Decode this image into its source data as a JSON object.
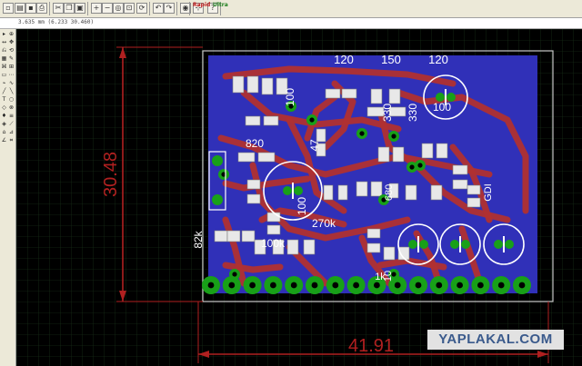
{
  "toolbar": {
    "buttons": [
      {
        "name": "new-file-icon",
        "glyph": "▫"
      },
      {
        "name": "open-folder-icon",
        "glyph": "▤"
      },
      {
        "name": "save-icon",
        "glyph": "▪"
      },
      {
        "name": "print-icon",
        "glyph": "⎙"
      },
      {
        "name": "cut-icon",
        "glyph": "✂"
      },
      {
        "name": "copy-icon",
        "glyph": "❐"
      },
      {
        "name": "paste-icon",
        "glyph": "▣"
      },
      {
        "name": "zoom-in-icon",
        "glyph": "+"
      },
      {
        "name": "zoom-out-icon",
        "glyph": "−"
      },
      {
        "name": "zoom-fit-icon",
        "glyph": "◎"
      },
      {
        "name": "zoom-window-icon",
        "glyph": "⊡"
      },
      {
        "name": "redraw-icon",
        "glyph": "⟳"
      },
      {
        "name": "undo-icon",
        "glyph": "↶"
      },
      {
        "name": "redo-icon",
        "glyph": "↷"
      },
      {
        "name": "stop-icon",
        "glyph": "◉"
      },
      {
        "name": "select-icon",
        "glyph": "⊹"
      },
      {
        "name": "help-icon",
        "glyph": "?"
      }
    ],
    "badge_rapid": "Rapid",
    "badge_ultra": "Ultra"
  },
  "status": {
    "coordinates": "3.635 mm (6.233 30.460)"
  },
  "left_tools": [
    "▸",
    "⊕",
    "↔",
    "✥",
    "⎌",
    "⟲",
    "▦",
    "✎",
    "⌘",
    "⊞",
    "▭",
    "⋯",
    "⌁",
    "∿",
    "╱",
    "╲",
    "T",
    "○",
    "◇",
    "⊗",
    "♦",
    "≡",
    "◈",
    "⟋",
    "⌂",
    "⊿",
    "∠",
    "⌗"
  ],
  "board": {
    "dimension_vertical": "30.48",
    "dimension_horizontal": "41.91",
    "component_labels": [
      {
        "text": "120"
      },
      {
        "text": "150"
      },
      {
        "text": "120"
      },
      {
        "text": "100"
      },
      {
        "text": "330"
      },
      {
        "text": "330"
      },
      {
        "text": "100"
      },
      {
        "text": "820"
      },
      {
        "text": "47"
      },
      {
        "text": "100"
      },
      {
        "text": "270k"
      },
      {
        "text": "82k"
      },
      {
        "text": "100k"
      },
      {
        "text": "10"
      },
      {
        "text": "680"
      },
      {
        "text": "1k"
      },
      {
        "text": "GDI"
      }
    ],
    "header_pin_count": 16
  },
  "colors": {
    "board_fill": "#3030b8",
    "trace": "#b03030",
    "pad": "#18a018",
    "grid": "#1e3c1e",
    "dimension": "#b02020"
  },
  "watermark": "YAPLAKAL.COM"
}
